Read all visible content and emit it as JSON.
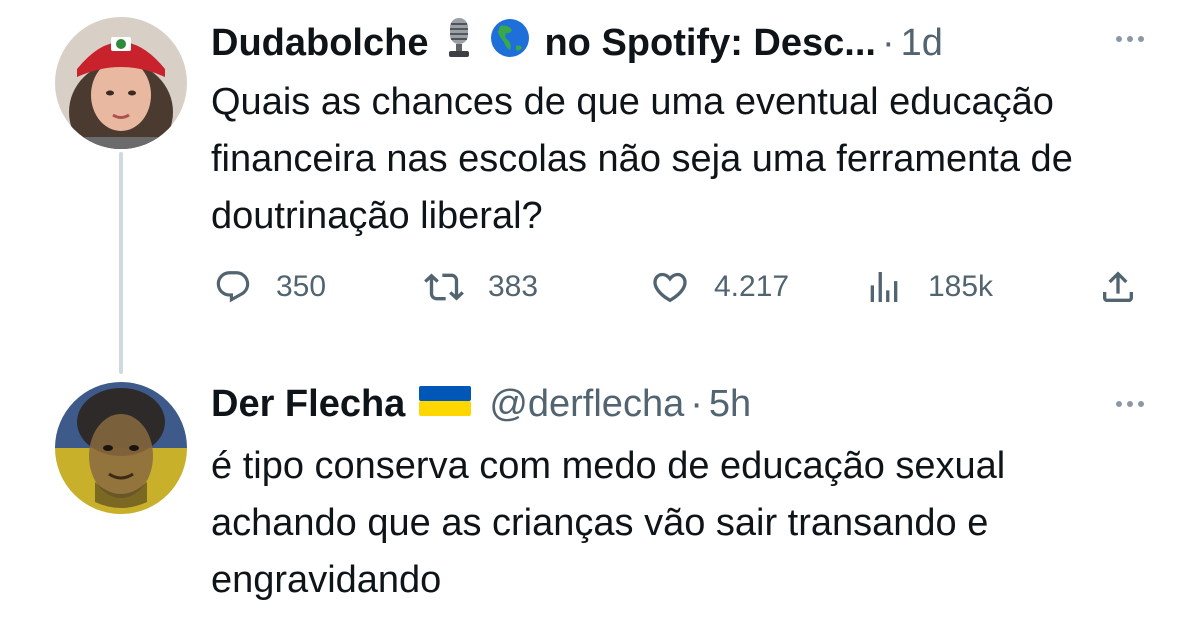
{
  "tweet1": {
    "name": "Dudabolche",
    "name_suffix": "no Spotify: Desc...",
    "emojis": [
      "microphone-emoji",
      "globe-americas-emoji"
    ],
    "time": "1d",
    "text": "Quais as chances de que uma eventual educação financeira nas escolas não seja uma ferramenta de doutrinação liberal?",
    "actions": {
      "replies": "350",
      "retweets": "383",
      "likes": "4.217",
      "views": "185k"
    }
  },
  "tweet2": {
    "name": "Der Flecha",
    "flag": "ukraine-flag",
    "handle": "@derflecha",
    "time": "5h",
    "text": "é tipo conserva com medo de educação sexual achando que as crianças vão sair transando e engravidando"
  },
  "colors": {
    "text_primary": "#0f1419",
    "text_secondary": "#536471",
    "thread_line": "#cfd9de",
    "ukraine_blue": "#0057b7",
    "ukraine_yellow": "#ffd700"
  }
}
